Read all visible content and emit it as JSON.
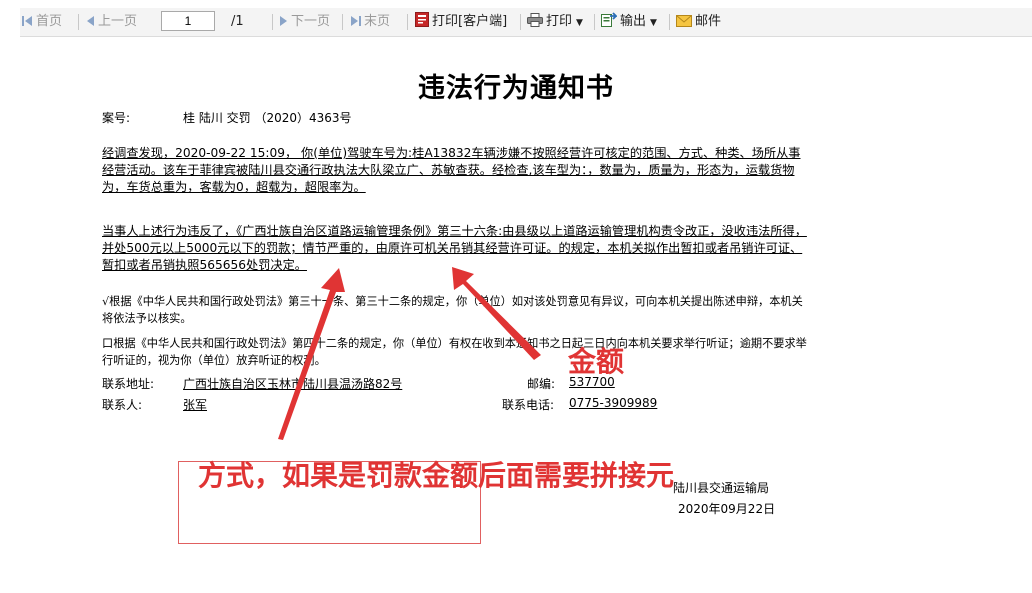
{
  "toolbar": {
    "first": "首页",
    "prev": "上一页",
    "page_value": "1",
    "page_total": "/1",
    "next": "下一页",
    "last": "末页",
    "print_client": "打印[客户端]",
    "print": "打印",
    "export": "输出",
    "mail": "邮件"
  },
  "document": {
    "title": "违法行为通知书",
    "case_label": "案号:",
    "case_value": "桂 陆川 交罚 （2020）4363号",
    "para1": "经调查发现，2020-09-22 15:09， 你(单位)驾驶车号为:桂A13832车辆涉嫌不按照经营许可核定的范围、方式、种类、场所从事经营活动。该车于菲律宾被陆川县交通行政执法大队梁立广、苏敏查获。经检查,该车型为：，数量为，质量为，形态为，运载货物为，车货总重为，客载为0，超载为，超限率为。",
    "para2": "当事人上述行为违反了，《广西壮族自治区道路运输管理条例》第三十六条:由县级以上道路运输管理机构责令改正，没收违法所得，并处500元以上5000元以下的罚款；情节严重的，由原许可机关吊销其经营许可证。的规定，本机关拟作出暂扣或者吊销许可证、暂扣或者吊销执照565656处罚决定。",
    "para3_mark": "√",
    "para3": "根据《中华人民共和国行政处罚法》第三十一条、第三十二条的规定，你（单位）如对该处罚意见有异议，可向本机关提出陈述申辩，本机关将依法予以核实。",
    "para4_mark": "口",
    "para4": "根据《中华人民共和国行政处罚法》第四十二条的规定，你（单位）有权在收到本通知书之日起三日内向本机关要求举行听证；逾期不要求举行听证的，视为你（单位）放弃听证的权利。",
    "address_label": "联系地址:",
    "address_value": "广西壮族自治区玉林市陆川县温汤路82号",
    "zip_label": "邮编:",
    "zip_value": "537700",
    "contact_label": "联系人:",
    "contact_value": "张军",
    "phone_label": "联系电话:",
    "phone_value": "0775-3909989",
    "agency": "陆川县交通运输局",
    "date": "2020年09月22日"
  },
  "annotations": {
    "amount": "金额",
    "method": "方式，如果是罚款金额后面需要拼接元",
    "color": "#e03434"
  },
  "icons": [
    "first-page-icon",
    "prev-page-icon",
    "next-page-icon",
    "last-page-icon",
    "pdf-icon",
    "printer-icon",
    "export-icon",
    "mail-icon"
  ]
}
